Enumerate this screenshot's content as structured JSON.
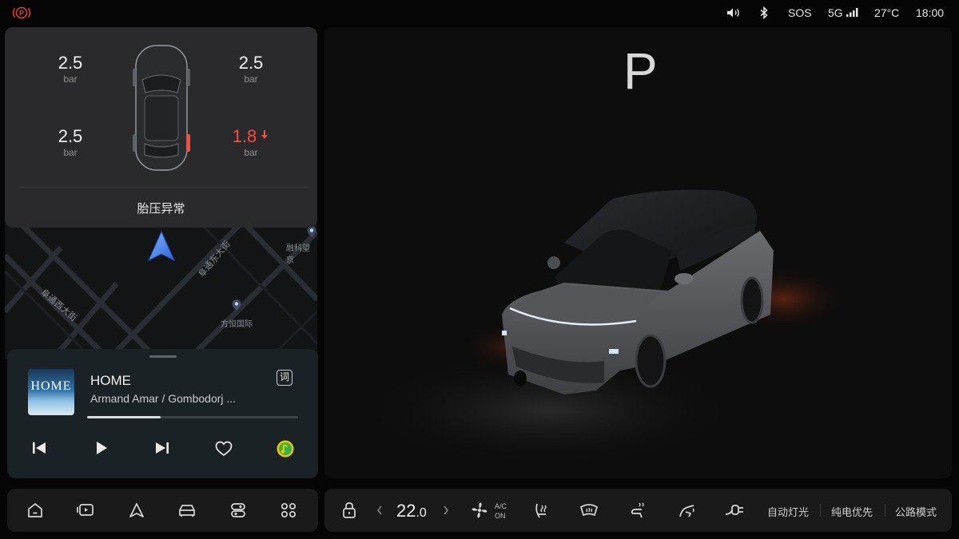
{
  "status_bar": {
    "sos": "SOS",
    "network": "5G",
    "temperature": "27°C",
    "time": "18:00"
  },
  "tire_pressure": {
    "unit": "bar",
    "front_left": "2.5",
    "front_right": "2.5",
    "rear_left": "2.5",
    "rear_right": "1.8",
    "status_text": "胎压异常",
    "alert_color": "#ff4a3d"
  },
  "map": {
    "street_1": "阜通西大街",
    "street_2": "阜通东大街",
    "poi_1": "方恒国际",
    "poi_2": "融科望京"
  },
  "music": {
    "album_title": "HOME",
    "track_title": "HOME",
    "artist": "Armand Amar / Gombodorj ...",
    "lyrics_button": "词",
    "progress": 0.35
  },
  "vehicle": {
    "gear": "P"
  },
  "climate": {
    "temperature_int": "22",
    "temperature_dec": ".0",
    "ac_top": "A/C",
    "ac_bottom": "ON"
  },
  "quick_actions": {
    "auto_lights": "自动灯光",
    "ev_priority": "纯电优先",
    "road_mode": "公路模式"
  },
  "colors": {
    "accent_blue": "#3f7ff0",
    "alert_red": "#ff4a3d",
    "music_app_green": "#f0c400"
  }
}
